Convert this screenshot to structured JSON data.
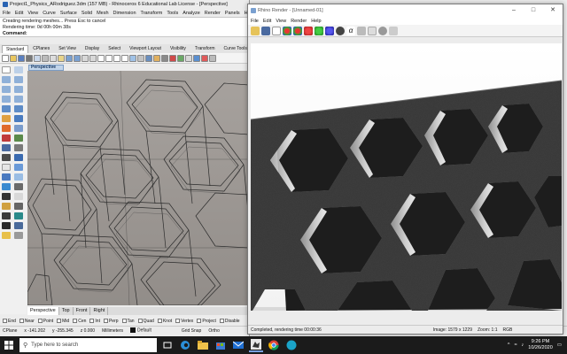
{
  "rhino": {
    "title": "Project1_Physics_ARodriguez.3dm (157 MB) - Rhinoceros 6 Educational Lab License - [Perspective]",
    "menu": [
      "File",
      "Edit",
      "View",
      "Curve",
      "Surface",
      "Solid",
      "Mesh",
      "Dimension",
      "Transform",
      "Tools",
      "Analyze",
      "Render",
      "Panels",
      "Help"
    ],
    "command_history": [
      "Creating rendering meshes... Press Esc to cancel",
      "Rendering time: 0d 00h 00m 38s"
    ],
    "command_label": "Command:",
    "ribbon_tabs": [
      "Standard",
      "CPlanes",
      "Set View",
      "Display",
      "Select",
      "Viewport Layout",
      "Visibility",
      "Transform",
      "Curve Tools"
    ],
    "viewport_label": "Perspective",
    "viewport_tabs": [
      "Perspective",
      "Top",
      "Front",
      "Right"
    ],
    "osnaps": [
      "End",
      "Near",
      "Point",
      "Mid",
      "Cen",
      "Int",
      "Perp",
      "Tan",
      "Quad",
      "Knot",
      "Vertex",
      "Project"
    ],
    "osnap_disable": "Disable"
  },
  "status": {
    "cplane": "CPlane",
    "x": "x -141.202",
    "y": "y -255.345",
    "z": "z 0.000",
    "units": "Millimeters",
    "layer": "Default",
    "grid_snap": "Grid Snap",
    "ortho": "Ortho"
  },
  "render_window": {
    "title": "Rhino Render - [Unnamed-01]",
    "menu": [
      "File",
      "Edit",
      "View",
      "Render",
      "Help"
    ],
    "status_message": "Completed, rendering time 00:00:36",
    "image_size": "Image: 1579 x 1229",
    "zoom": "Zoom: 1:1",
    "color_mode": "RGB"
  },
  "taskbar": {
    "search_placeholder": "Type here to search",
    "time": "9:26 PM",
    "date": "10/26/2020"
  }
}
